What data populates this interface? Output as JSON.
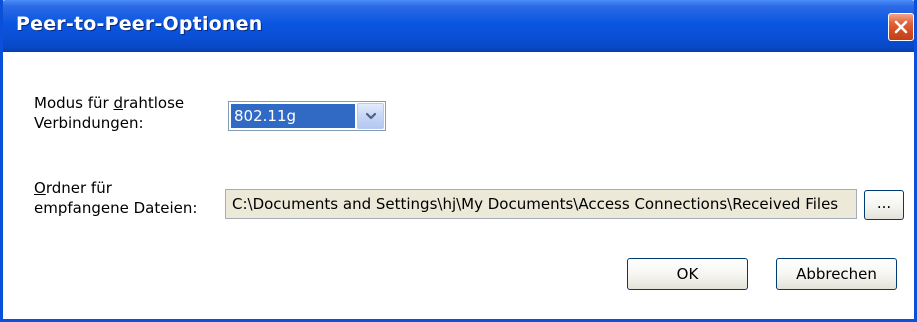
{
  "window": {
    "title": "Peer-to-Peer-Optionen"
  },
  "icons": {
    "close": "close-icon",
    "dropdown": "chevron-down-icon"
  },
  "colors": {
    "titlebar": "#0a56e0",
    "selection": "#316ac5",
    "close_button": "#d24a1e",
    "disabled_field": "#ece9d8"
  },
  "wireless_mode": {
    "label_prefix": "Modus für ",
    "label_accel": "d",
    "label_rest": "rahtlose",
    "label_line2": "Verbindungen:",
    "selected": "802.11g"
  },
  "folder": {
    "label_accel": "O",
    "label_rest": "rdner für",
    "label_line2": "empfangene Dateien:",
    "path": "C:\\Documents and Settings\\hj\\My Documents\\Access Connections\\Received Files",
    "browse_label": "..."
  },
  "buttons": {
    "ok": "OK",
    "cancel": "Abbrechen"
  }
}
